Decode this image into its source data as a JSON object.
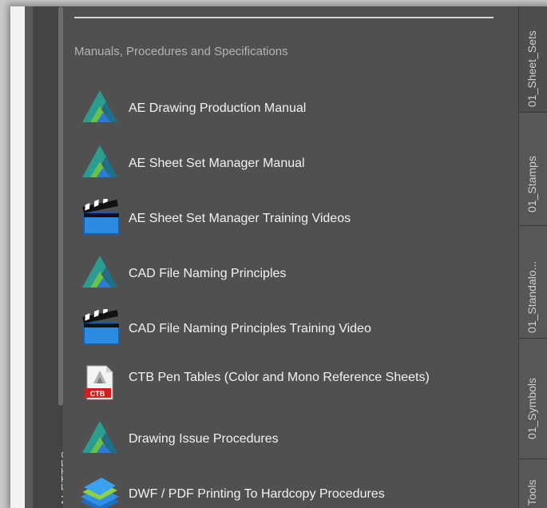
{
  "left_bar": {
    "palettes_label": "ALETTES"
  },
  "section": {
    "header": "Manuals, Procedures and Specifications"
  },
  "items": [
    {
      "label": "AE Drawing Production Manual",
      "icon": "autocad-icon"
    },
    {
      "label": "AE Sheet Set Manager Manual",
      "icon": "autocad-icon"
    },
    {
      "label": "AE Sheet Set Manager Training Videos",
      "icon": "clapperboard-icon"
    },
    {
      "label": "CAD File Naming Principles",
      "icon": "autocad-icon"
    },
    {
      "label": "CAD File Naming Principles Training Video",
      "icon": "clapperboard-icon"
    },
    {
      "label": "CTB Pen Tables (Color and Mono Reference Sheets)",
      "icon": "ctb-file-icon",
      "icon_text": "CTB"
    },
    {
      "label": "Drawing Issue Procedures",
      "icon": "autocad-icon"
    },
    {
      "label": "DWF / PDF Printing To Hardcopy Procedures",
      "icon": "books-icon"
    }
  ],
  "tabs": [
    {
      "label": "01_Sheet_Sets"
    },
    {
      "label": "01_Stamps"
    },
    {
      "label": "01_Standalo..."
    },
    {
      "label": "01_Symbols"
    },
    {
      "label": "Tools"
    }
  ]
}
